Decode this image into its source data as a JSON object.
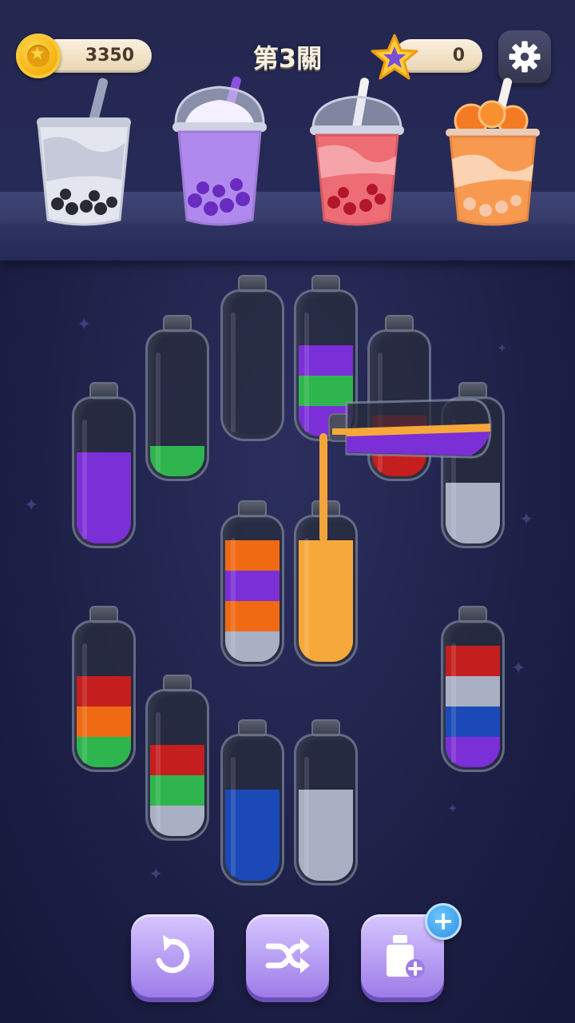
{
  "header": {
    "coins": "3350",
    "level_title": "第3關",
    "stars": "0",
    "icons": [
      "coin-icon",
      "star-icon",
      "gear-icon"
    ]
  },
  "shelf_drinks": [
    {
      "name": "taro-milk-tea",
      "icon": "cup-icon"
    },
    {
      "name": "purple-bubble-tea",
      "icon": "cup-icon"
    },
    {
      "name": "strawberry-tea",
      "icon": "cup-icon"
    },
    {
      "name": "orange-tea",
      "icon": "cup-icon"
    }
  ],
  "colors": {
    "purple": "#7b2fd6",
    "green": "#2fb54e",
    "orange": "#f06a14",
    "red": "#c41e1e",
    "grey": "#a9b0c4",
    "blue": "#1b49b8",
    "yellow": "#f6a83a"
  },
  "bottles": [
    {
      "id": 1,
      "layers": []
    },
    {
      "id": 2,
      "layers": [
        "purple",
        "green",
        "purple"
      ]
    },
    {
      "id": 3,
      "layers": [
        "green"
      ]
    },
    {
      "id": 4,
      "layers": [
        "red",
        "red"
      ]
    },
    {
      "id": 5,
      "layers": [
        "purple",
        "purple",
        "purple"
      ]
    },
    {
      "id": 6,
      "layers": [
        "grey",
        "grey"
      ]
    },
    {
      "id": 7,
      "layers": [
        "grey",
        "orange",
        "purple",
        "orange"
      ]
    },
    {
      "id": 8,
      "layers": [
        "yellow",
        "yellow",
        "yellow",
        "yellow"
      ]
    },
    {
      "id": 9,
      "layers": [
        "green",
        "orange",
        "red"
      ]
    },
    {
      "id": 10,
      "layers": [
        "purple",
        "blue",
        "grey",
        "red"
      ]
    },
    {
      "id": 11,
      "layers": [
        "grey",
        "green",
        "red"
      ]
    },
    {
      "id": 12,
      "layers": [
        "blue",
        "blue",
        "blue"
      ]
    },
    {
      "id": 13,
      "layers": [
        "grey",
        "grey",
        "grey"
      ]
    }
  ],
  "pouring_bottle": {
    "from_bottle": 4,
    "to_bottle": 8,
    "layers": [
      "purple",
      "yellow"
    ]
  },
  "toolbar": [
    {
      "name": "undo-button",
      "icon": "undo-icon"
    },
    {
      "name": "shuffle-button",
      "icon": "shuffle-icon"
    },
    {
      "name": "add-bottle-button",
      "icon": "add-bottle-icon",
      "badge": "+"
    }
  ]
}
